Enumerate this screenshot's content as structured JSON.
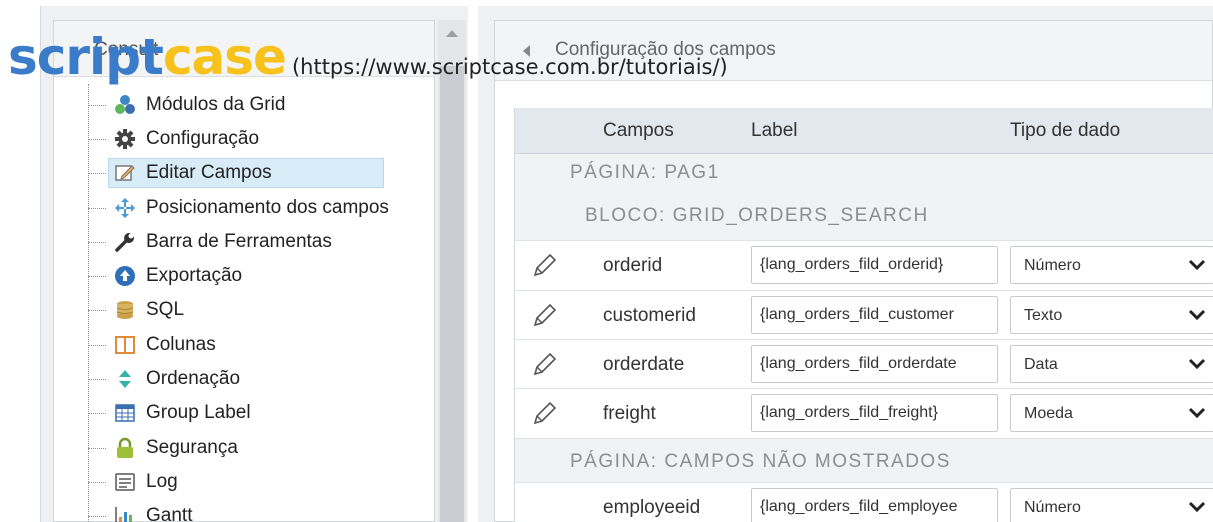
{
  "watermark": {
    "brand_part1": "script",
    "brand_part2": "case",
    "url": "(https://www.scriptcase.com.br/tutoriais/)",
    "color_script": "#3a7cc9",
    "color_case": "#f6c21b"
  },
  "tree": {
    "header": "Consult",
    "items": [
      {
        "label": "Módulos da Grid",
        "icon": "modules-icon"
      },
      {
        "label": "Configuração",
        "icon": "gear-icon"
      },
      {
        "label": "Editar Campos",
        "icon": "edit-fields-icon",
        "selected": true
      },
      {
        "label": "Posicionamento dos campos",
        "icon": "move-arrows-icon"
      },
      {
        "label": "Barra de Ferramentas",
        "icon": "wrench-icon"
      },
      {
        "label": "Exportação",
        "icon": "export-icon"
      },
      {
        "label": "SQL",
        "icon": "database-icon"
      },
      {
        "label": "Colunas",
        "icon": "columns-icon"
      },
      {
        "label": "Ordenação",
        "icon": "sort-icon"
      },
      {
        "label": "Group Label",
        "icon": "table-icon"
      },
      {
        "label": "Segurança",
        "icon": "lock-icon"
      },
      {
        "label": "Log",
        "icon": "log-icon"
      },
      {
        "label": "Gantt",
        "icon": "gantt-chart-icon"
      }
    ]
  },
  "panel": {
    "title": "Configuração dos campos"
  },
  "grid": {
    "headers": {
      "campos": "Campos",
      "label": "Label",
      "tipo": "Tipo de dado"
    },
    "sections": {
      "page1": "PÁGINA: PAG1",
      "block1": "BLOCO: GRID_ORDERS_SEARCH",
      "page2": "PÁGINA: CAMPOS NÃO MOSTRADOS"
    },
    "rows": [
      {
        "field": "orderid",
        "label": "{lang_orders_fild_orderid}",
        "type": "Número"
      },
      {
        "field": "customerid",
        "label": "{lang_orders_fild_customer",
        "type": "Texto"
      },
      {
        "field": "orderdate",
        "label": "{lang_orders_fild_orderdate",
        "type": "Data"
      },
      {
        "field": "freight",
        "label": "{lang_orders_fild_freight}",
        "type": "Moeda"
      },
      {
        "field": "employeeid",
        "label": "{lang_orders_fild_employee",
        "type": "Número"
      }
    ]
  }
}
